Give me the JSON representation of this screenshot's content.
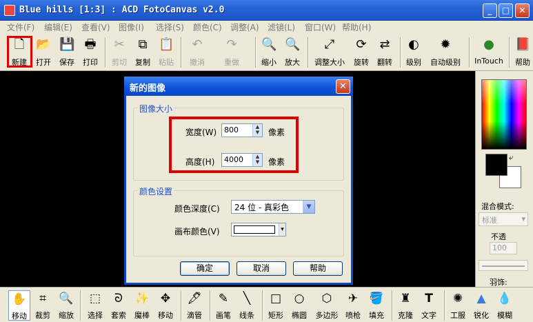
{
  "window": {
    "title": "Blue hills [1:3] : ACD FotoCanvas v2.0",
    "controls": [
      "_",
      "□",
      "✕"
    ]
  },
  "menu": [
    "文件(F)",
    "编辑(E)",
    "查看(V)",
    "图像(I)",
    "选择(S)",
    "颜色(C)",
    "调整(A)",
    "滤镜(L)",
    "窗口(W)",
    "帮助(H)"
  ],
  "toolbar": [
    {
      "label": "新建",
      "icon": "🗋"
    },
    {
      "label": "打开",
      "icon": "📂"
    },
    {
      "label": "保存",
      "icon": "💾"
    },
    {
      "label": "打印",
      "icon": "🖶"
    },
    {
      "label": "剪切",
      "icon": "✂"
    },
    {
      "label": "复制",
      "icon": "⧉"
    },
    {
      "label": "粘贴",
      "icon": "📋"
    },
    {
      "label": "撤消",
      "icon": "↶"
    },
    {
      "label": "重做",
      "icon": "↷"
    },
    {
      "label": "缩小",
      "icon": "🔍"
    },
    {
      "label": "放大",
      "icon": "🔍"
    },
    {
      "label": "调整大小",
      "icon": "⤢"
    },
    {
      "label": "旋转",
      "icon": "⟳"
    },
    {
      "label": "翻转",
      "icon": "⇄"
    },
    {
      "label": "级别",
      "icon": "◐"
    },
    {
      "label": "自动级别",
      "icon": "✹"
    },
    {
      "label": "InTouch",
      "icon": "●"
    },
    {
      "label": "帮助",
      "icon": "📕"
    }
  ],
  "right_panel": {
    "blend_label": "混合模式:",
    "blend_value": "标准",
    "opacity_label": "不透",
    "opacity_value": "100",
    "feather_label": "羽饰:"
  },
  "tools": [
    {
      "label": "移动",
      "icon": "✋"
    },
    {
      "label": "裁剪",
      "icon": "⌗"
    },
    {
      "label": "缩放",
      "icon": "🔍"
    },
    {
      "label": "选择",
      "icon": "⬚"
    },
    {
      "label": "套索",
      "icon": "ᘐ"
    },
    {
      "label": "魔棒",
      "icon": "✨"
    },
    {
      "label": "移动",
      "icon": "✥"
    },
    {
      "label": "滴管",
      "icon": "🖋"
    },
    {
      "label": "画笔",
      "icon": "✎"
    },
    {
      "label": "线条",
      "icon": "╲"
    },
    {
      "label": "矩形",
      "icon": "□"
    },
    {
      "label": "椭圆",
      "icon": "○"
    },
    {
      "label": "多边形",
      "icon": "⬡"
    },
    {
      "label": "喷枪",
      "icon": "✈"
    },
    {
      "label": "填充",
      "icon": "🪣"
    },
    {
      "label": "克隆",
      "icon": "♜"
    },
    {
      "label": "文字",
      "icon": "T"
    },
    {
      "label": "工服",
      "icon": "✺"
    },
    {
      "label": "锐化",
      "icon": "▲"
    },
    {
      "label": "模糊",
      "icon": "💧"
    }
  ],
  "dialog": {
    "title": "新的图像",
    "size_group": "图像大小",
    "width_label": "宽度(W)",
    "width_value": "800",
    "width_unit": "像素",
    "height_label": "高度(H)",
    "height_value": "4000",
    "height_unit": "像素",
    "color_group": "颜色设置",
    "depth_label": "颜色深度(C)",
    "depth_value": "24 位 - 真彩色",
    "canvas_label": "画布颜色(V)",
    "ok": "确定",
    "cancel": "取消",
    "help": "帮助"
  }
}
